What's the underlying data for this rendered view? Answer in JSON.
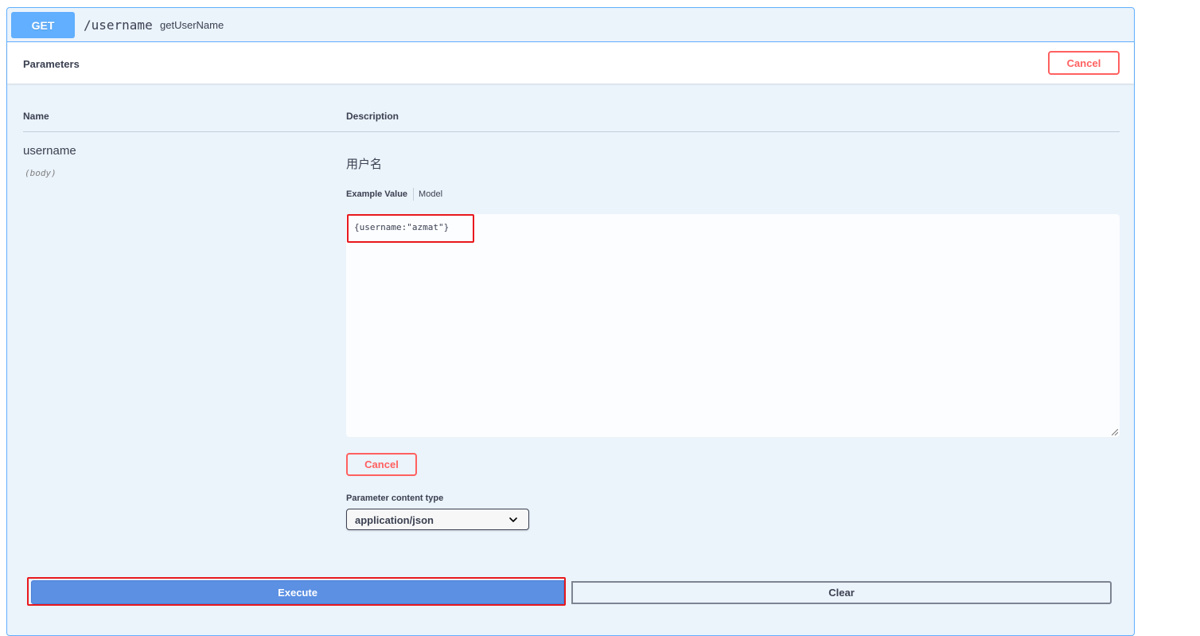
{
  "operation": {
    "method": "GET",
    "path": "/username",
    "summary": "getUserName"
  },
  "parameters": {
    "title": "Parameters",
    "cancel_label": "Cancel",
    "columns": {
      "name": "Name",
      "description": "Description"
    },
    "items": [
      {
        "name": "username",
        "in": "(body)",
        "description": "用户名",
        "tabs": {
          "example_value": "Example Value",
          "model": "Model"
        },
        "value": "{username:\"azmat\"}",
        "cancel_label": "Cancel",
        "content_type_label": "Parameter content type",
        "content_type_selected": "application/json"
      }
    ]
  },
  "actions": {
    "execute_label": "Execute",
    "clear_label": "Clear"
  },
  "colors": {
    "method_get": "#61affe",
    "cancel": "#ff6060",
    "execute": "#5b90e3",
    "highlight": "#e8191d"
  }
}
